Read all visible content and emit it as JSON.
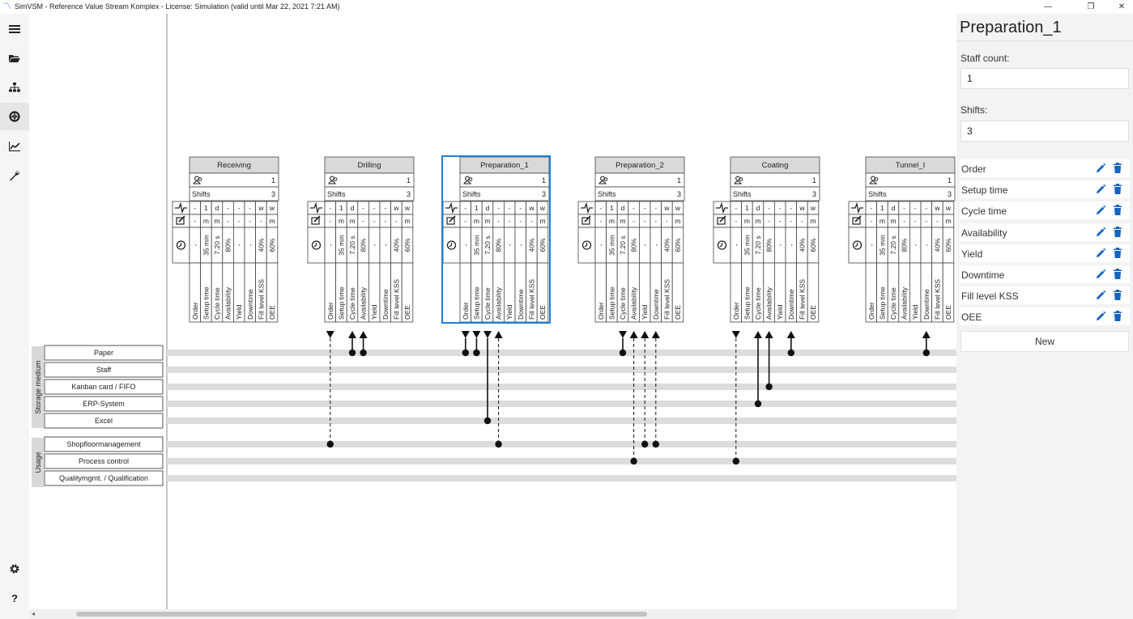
{
  "window": {
    "title": "SimVSM - Reference Value Stream Komplex - License: Simulation (valid until Mar 22, 2021 7:21 AM)",
    "minimize": "—",
    "maximize": "❐",
    "close": "✕"
  },
  "nav": [
    {
      "icon": "menu-icon",
      "active": false
    },
    {
      "icon": "folder-open-icon",
      "active": false
    },
    {
      "icon": "sitemap-icon",
      "active": false
    },
    {
      "icon": "lifebuoy-icon",
      "active": true
    },
    {
      "icon": "chart-line-icon",
      "active": false
    },
    {
      "icon": "wrench-icon",
      "active": false
    },
    {
      "icon": "gear-icon",
      "active": false
    },
    {
      "icon": "help-icon",
      "active": false
    }
  ],
  "process_template": {
    "shifts_label": "Shifts",
    "columns": [
      "Order",
      "Setup time",
      "Cycle time",
      "Availability",
      "Yield",
      "Downtime",
      "Fill level KSS",
      "OEE"
    ],
    "row_pulse": [
      "-",
      "1",
      "d",
      "-",
      "-",
      "-",
      "w",
      "w"
    ],
    "row_edit": [
      "-",
      "m",
      "m",
      "-",
      "-",
      "-",
      "-",
      "m"
    ],
    "row_time": [
      "-",
      "35 min",
      "7.20 s",
      "80%",
      "-",
      "-",
      "40%",
      "60%"
    ]
  },
  "processes": [
    {
      "name": "Receiving",
      "staff": "1",
      "shifts": "3",
      "selected": false
    },
    {
      "name": "Drilling",
      "staff": "1",
      "shifts": "3",
      "selected": false
    },
    {
      "name": "Preparation_1",
      "staff": "1",
      "shifts": "3",
      "selected": true
    },
    {
      "name": "Preparation_2",
      "staff": "1",
      "shifts": "3",
      "selected": false
    },
    {
      "name": "Coating",
      "staff": "1",
      "shifts": "3",
      "selected": false
    },
    {
      "name": "Tunnel_I",
      "staff": "1",
      "shifts": "3",
      "selected": false
    }
  ],
  "lane_groups": [
    {
      "label": "Storage medium",
      "lanes": [
        "Paper",
        "Staff",
        "Kanban card / FIFO",
        "ERP-System",
        "Excel"
      ]
    },
    {
      "label": "Usage",
      "lanes": [
        "Shopfloormanagement",
        "Process control",
        "Qualitymgmt. / Qualification"
      ]
    }
  ],
  "panel": {
    "title": "Preparation_1",
    "staff_label": "Staff count:",
    "staff_value": "1",
    "shifts_label": "Shifts:",
    "shifts_value": "3",
    "rows": [
      "Order",
      "Setup time",
      "Cycle time",
      "Availability",
      "Yield",
      "Downtime",
      "Fill level KSS",
      "OEE"
    ],
    "new_label": "New"
  },
  "colors": {
    "selected": "#1e7fd6",
    "accent_icon": "#1565c0",
    "lane": "#dcdcdc",
    "header_fill": "#d9d9d9"
  }
}
